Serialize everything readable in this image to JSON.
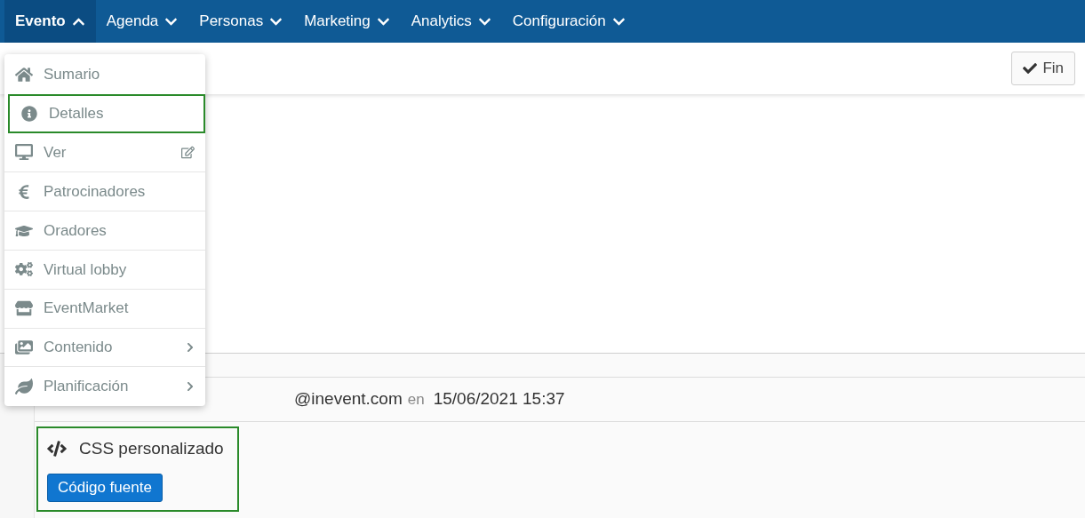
{
  "nav": [
    {
      "label": "Evento",
      "selected": true,
      "expanded": true
    },
    {
      "label": "Agenda",
      "selected": false,
      "expanded": false
    },
    {
      "label": "Personas",
      "selected": false,
      "expanded": false
    },
    {
      "label": "Marketing",
      "selected": false,
      "expanded": false
    },
    {
      "label": "Analytics",
      "selected": false,
      "expanded": false
    },
    {
      "label": "Configuración",
      "selected": false,
      "expanded": false
    }
  ],
  "toolbar": {
    "done_button": "Fin"
  },
  "menu": [
    {
      "label": "Sumario",
      "kind": "plain",
      "highlighted": false
    },
    {
      "label": "Detalles",
      "kind": "plain",
      "highlighted": true
    },
    {
      "label": "Ver",
      "kind": "external",
      "highlighted": false
    },
    {
      "label": "Patrocinadores",
      "kind": "plain",
      "highlighted": false
    },
    {
      "label": "Oradores",
      "kind": "plain",
      "highlighted": false
    },
    {
      "label": "Virtual lobby",
      "kind": "plain",
      "highlighted": false
    },
    {
      "label": "EventMarket",
      "kind": "plain",
      "highlighted": false
    },
    {
      "label": "Contenido",
      "kind": "submenu",
      "highlighted": false
    },
    {
      "label": "Planificación",
      "kind": "submenu",
      "highlighted": false
    }
  ],
  "log": {
    "email": "@inevent.com",
    "connector": "en",
    "timestamp": "15/06/2021 15:37"
  },
  "custom_css": {
    "title": "CSS personalizado",
    "button": "Código fuente",
    "highlighted": true
  }
}
